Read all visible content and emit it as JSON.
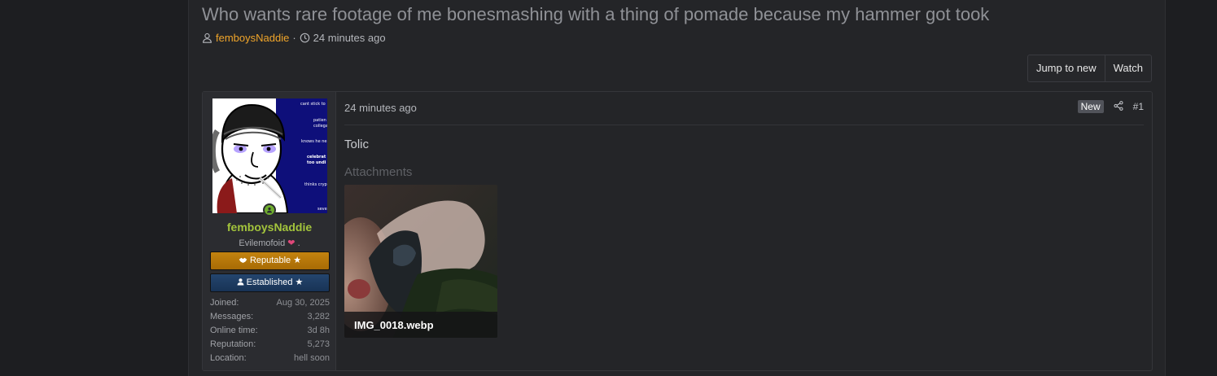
{
  "thread": {
    "title": "Who wants rare footage of me bonesmashing with a thing of pomade because my hammer got took",
    "author": "femboysNaddie",
    "separator": "·",
    "time": "24 minutes ago"
  },
  "actions": {
    "jump_to_new": "Jump to new",
    "watch": "Watch"
  },
  "post": {
    "user": {
      "name": "femboysNaddie",
      "title": "Evilemofoid",
      "title_suffix": ".",
      "banners": [
        "Reputable ★",
        "Established ★"
      ],
      "avatar_texts": [
        "cant stick to",
        "patien",
        "collega",
        "knows he ne",
        "celebrat",
        "too undi",
        "thinks cryp",
        "seven"
      ],
      "stats": [
        {
          "label": "Joined:",
          "value": "Aug 30, 2025"
        },
        {
          "label": "Messages:",
          "value": "3,282"
        },
        {
          "label": "Online time:",
          "value": "3d 8h"
        },
        {
          "label": "Reputation:",
          "value": "5,273"
        },
        {
          "label": "Location:",
          "value": "hell soon"
        }
      ]
    },
    "date": "24 minutes ago",
    "badge": "New",
    "number": "#1",
    "body": "Tolic",
    "attachments_heading": "Attachments",
    "attachment": {
      "filename": "IMG_0018.webp"
    }
  },
  "colors": {
    "author": "#f0a52a",
    "username": "#a3c43c",
    "reputable": "#c3830f",
    "established": "#24456e",
    "online": "#6fae2f"
  }
}
